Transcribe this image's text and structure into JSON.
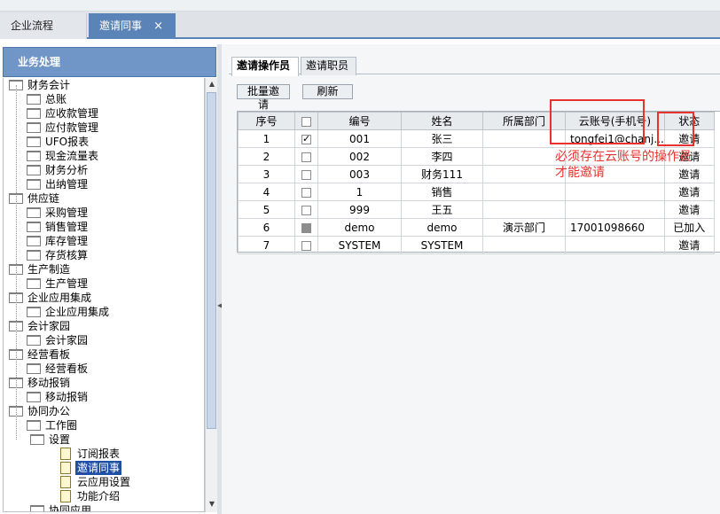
{
  "tabs": [
    {
      "label": "企业流程",
      "active": false
    },
    {
      "label": "邀请同事",
      "active": true,
      "close": "×"
    }
  ],
  "left_panel": {
    "title": "业务处理",
    "tree": [
      {
        "label": "财务会计",
        "level": 0,
        "type": "folder"
      },
      {
        "label": "总账",
        "level": 1,
        "type": "folder"
      },
      {
        "label": "应收款管理",
        "level": 1,
        "type": "folder"
      },
      {
        "label": "应付款管理",
        "level": 1,
        "type": "folder"
      },
      {
        "label": "UFO报表",
        "level": 1,
        "type": "folder"
      },
      {
        "label": "现金流量表",
        "level": 1,
        "type": "folder"
      },
      {
        "label": "财务分析",
        "level": 1,
        "type": "folder"
      },
      {
        "label": "出纳管理",
        "level": 1,
        "type": "folder"
      },
      {
        "label": "供应链",
        "level": 0,
        "type": "folder"
      },
      {
        "label": "采购管理",
        "level": 1,
        "type": "folder"
      },
      {
        "label": "销售管理",
        "level": 1,
        "type": "folder"
      },
      {
        "label": "库存管理",
        "level": 1,
        "type": "folder"
      },
      {
        "label": "存货核算",
        "level": 1,
        "type": "folder"
      },
      {
        "label": "生产制造",
        "level": 0,
        "type": "folder"
      },
      {
        "label": "生产管理",
        "level": 1,
        "type": "folder"
      },
      {
        "label": "企业应用集成",
        "level": 0,
        "type": "folder"
      },
      {
        "label": "企业应用集成",
        "level": 1,
        "type": "folder"
      },
      {
        "label": "会计家园",
        "level": 0,
        "type": "folder"
      },
      {
        "label": "会计家园",
        "level": 1,
        "type": "folder"
      },
      {
        "label": "经营看板",
        "level": 0,
        "type": "folder"
      },
      {
        "label": "经营看板",
        "level": 1,
        "type": "folder"
      },
      {
        "label": "移动报销",
        "level": 0,
        "type": "folder"
      },
      {
        "label": "移动报销",
        "level": 1,
        "type": "folder"
      },
      {
        "label": "协同办公",
        "level": 0,
        "type": "folder"
      },
      {
        "label": "工作圈",
        "level": 1,
        "type": "folder"
      },
      {
        "label": "设置",
        "level": 2,
        "type": "folder"
      },
      {
        "label": "订阅报表",
        "level": 3,
        "type": "doc"
      },
      {
        "label": "邀请同事",
        "level": 3,
        "type": "doc",
        "selected": true
      },
      {
        "label": "云应用设置",
        "level": 3,
        "type": "doc"
      },
      {
        "label": "功能介绍",
        "level": 3,
        "type": "doc"
      },
      {
        "label": "协同应用",
        "level": 2,
        "type": "folder"
      }
    ]
  },
  "subtabs": [
    "邀请操作员",
    "邀请职员"
  ],
  "toolbar": {
    "batch_invite": "批量邀请",
    "refresh": "刷新"
  },
  "grid": {
    "columns": [
      "序号",
      "",
      "编号",
      "姓名",
      "所属部门",
      "云账号(手机号)",
      "状态"
    ],
    "rows": [
      {
        "no": "1",
        "check": "checked",
        "code": "001",
        "name": "张三",
        "dept": "",
        "account": "tongfei1@chanj...",
        "status": "邀请"
      },
      {
        "no": "2",
        "check": "empty",
        "code": "002",
        "name": "李四",
        "dept": "",
        "account": "",
        "status": "邀请"
      },
      {
        "no": "3",
        "check": "empty",
        "code": "003",
        "name": "财务111",
        "dept": "",
        "account": "",
        "status": "邀请"
      },
      {
        "no": "4",
        "check": "empty",
        "code": "1",
        "name": "销售",
        "dept": "",
        "account": "",
        "status": "邀请"
      },
      {
        "no": "5",
        "check": "empty",
        "code": "999",
        "name": "王五",
        "dept": "",
        "account": "",
        "status": "邀请"
      },
      {
        "no": "6",
        "check": "filled",
        "code": "demo",
        "name": "demo",
        "dept": "演示部门",
        "account": "17001098660",
        "status": "已加入"
      },
      {
        "no": "7",
        "check": "empty",
        "code": "SYSTEM",
        "name": "SYSTEM",
        "dept": "",
        "account": "",
        "status": "邀请"
      }
    ]
  },
  "annotation": {
    "line1": "必须存在云账号的操作员",
    "line2": "才能邀请",
    "color": "#e8322f"
  },
  "colors": {
    "tab_active": "#5a84b8",
    "left_header": "#6f96c6",
    "selection": "#1e4fa3"
  }
}
